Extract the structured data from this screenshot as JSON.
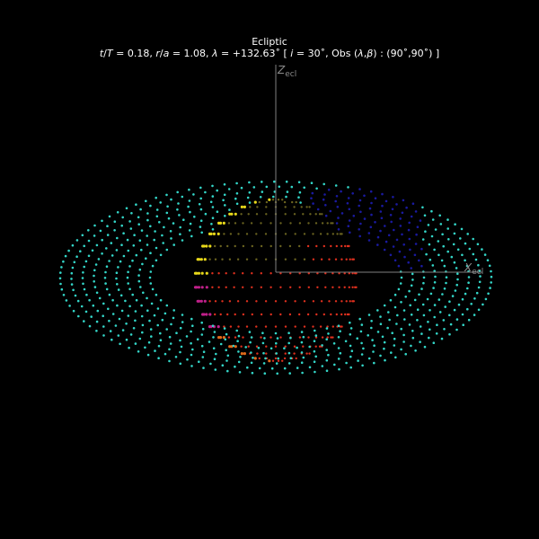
{
  "figure": {
    "title": "Ecliptic",
    "t_over_T": "0.18",
    "r_over_a": "1.08",
    "lambda": "+132.63",
    "inclination": "30",
    "obs_lambda": "90",
    "obs_beta": "90"
  },
  "axes": {
    "z_label": "Z",
    "z_sub": "ecl",
    "x_label": "X",
    "x_sub": "ecl",
    "axis_color": "#808080"
  },
  "colors": {
    "ring": "#33d6c8",
    "planet_day": "#e0301e",
    "planet_night": "#6b6420",
    "limb_yellow": "#e8d81a",
    "limb_magenta": "#c0208a",
    "limb_orange": "#e06a1a",
    "occulted": "#1a1aa0"
  }
}
